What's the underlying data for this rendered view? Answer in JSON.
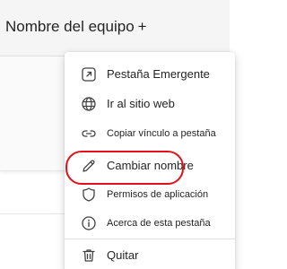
{
  "header": {
    "title": "Nombre del equipo",
    "add_symbol": "+"
  },
  "menu": {
    "items": [
      {
        "label": "Pestaña Emergente",
        "icon": "popout-icon"
      },
      {
        "label": "Ir al sitio web",
        "icon": "globe-icon"
      },
      {
        "label": "Copiar vínculo a pestaña",
        "icon": "link-icon"
      },
      {
        "label": "Cambiar nombre",
        "icon": "pencil-icon"
      },
      {
        "label": "Permisos de aplicación",
        "icon": "shield-icon"
      },
      {
        "label": "Acerca de esta pestaña",
        "icon": "info-icon"
      },
      {
        "label": "Quitar",
        "icon": "trash-icon"
      }
    ]
  },
  "colors": {
    "highlight": "#e3101a",
    "header_bg": "#f5f5f5"
  }
}
